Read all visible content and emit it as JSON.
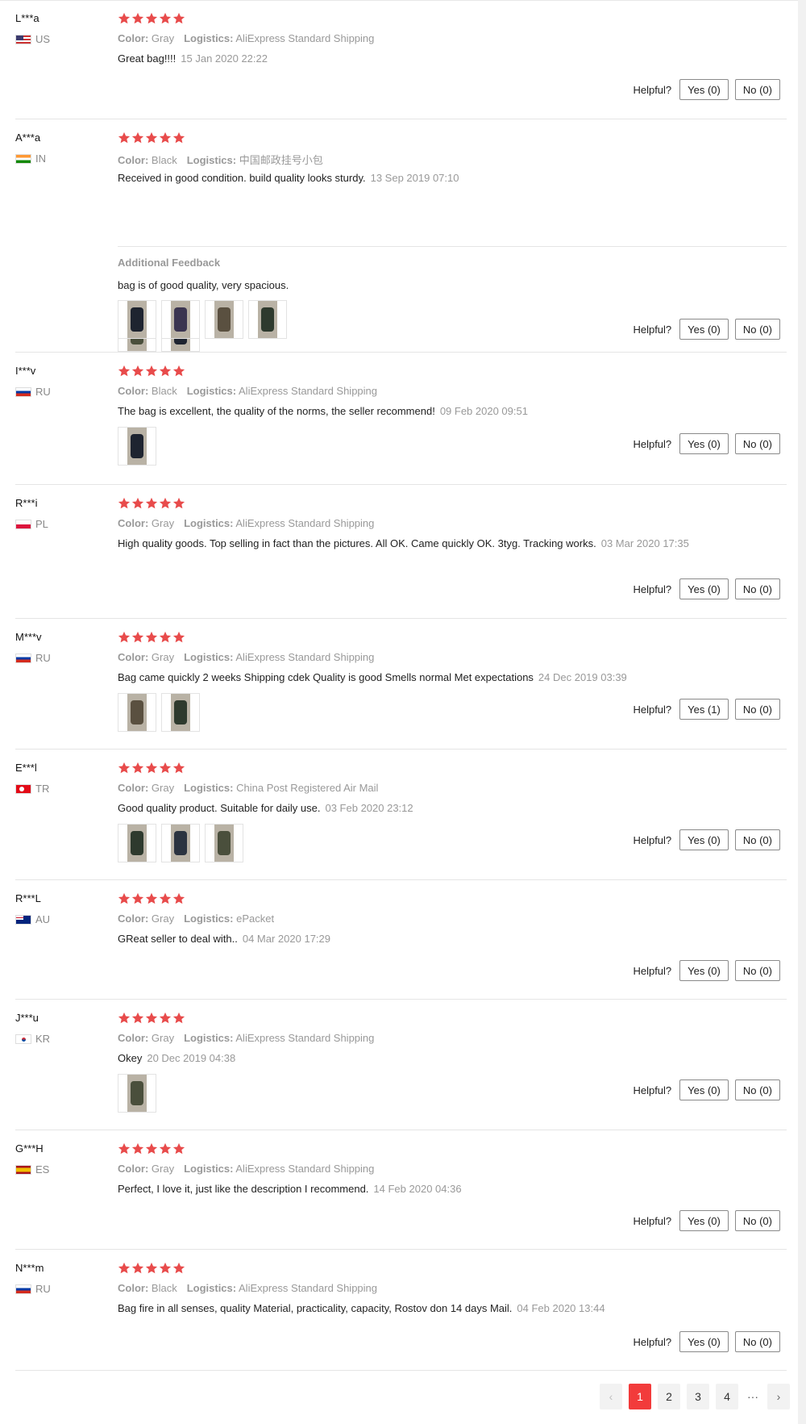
{
  "labels": {
    "color": "Color:",
    "logistics": "Logistics:",
    "helpful": "Helpful?",
    "additional_feedback": "Additional Feedback"
  },
  "colors": {
    "star": "#e84b4b",
    "accent": "#f23b3b",
    "muted": "#999999",
    "divider": "#e5e5e5"
  },
  "reviews": [
    {
      "user": "L***a",
      "country": "US",
      "flag": "us-flag-icon",
      "rating": 5,
      "color": "Gray",
      "logistics": "AliExpress Standard Shipping",
      "text": "Great bag!!!!",
      "date": "15 Jan 2020 22:22",
      "photos": 0,
      "yes": "Yes (0)",
      "no": "No (0)"
    },
    {
      "user": "A***a",
      "country": "IN",
      "flag": "in-flag-icon",
      "rating": 5,
      "color": "Black",
      "logistics": "中国邮政挂号小包",
      "text": "Received in good condition. build quality looks sturdy.",
      "date": "13 Sep 2019 07:10",
      "photos": 2,
      "yes": "Yes (0)",
      "no": "No (0)",
      "additional": {
        "text": "bag is of good quality, very spacious.",
        "photos": 4
      }
    },
    {
      "user": "I***v",
      "country": "RU",
      "flag": "ru-flag-icon",
      "rating": 5,
      "color": "Black",
      "logistics": "AliExpress Standard Shipping",
      "text": "The bag is excellent, the quality of the norms, the seller recommend!",
      "date": "09 Feb 2020 09:51",
      "photos": 1,
      "yes": "Yes (0)",
      "no": "No (0)"
    },
    {
      "user": "R***i",
      "country": "PL",
      "flag": "pl-flag-icon",
      "rating": 5,
      "color": "Gray",
      "logistics": "AliExpress Standard Shipping",
      "text": "High quality goods. Top selling in fact than the pictures. All OK. Came quickly OK. 3tyg. Tracking works.",
      "date": "03 Mar 2020 17:35",
      "photos": 0,
      "yes": "Yes (0)",
      "no": "No (0)"
    },
    {
      "user": "M***v",
      "country": "RU",
      "flag": "ru-flag-icon",
      "rating": 5,
      "color": "Gray",
      "logistics": "AliExpress Standard Shipping",
      "text": "Bag came quickly 2 weeks Shipping cdek Quality is good Smells normal Met expectations",
      "date": "24 Dec 2019 03:39",
      "photos": 2,
      "yes": "Yes (1)",
      "no": "No (0)"
    },
    {
      "user": "E***l",
      "country": "TR",
      "flag": "tr-flag-icon",
      "rating": 5,
      "color": "Gray",
      "logistics": "China Post Registered Air Mail",
      "text": "Good quality product. Suitable for daily use.",
      "date": "03 Feb 2020 23:12",
      "photos": 3,
      "yes": "Yes (0)",
      "no": "No (0)"
    },
    {
      "user": "R***L",
      "country": "AU",
      "flag": "au-flag-icon",
      "rating": 5,
      "color": "Gray",
      "logistics": "ePacket",
      "text": "GReat seller to deal with..",
      "date": "04 Mar 2020 17:29",
      "photos": 0,
      "yes": "Yes (0)",
      "no": "No (0)"
    },
    {
      "user": "J***u",
      "country": "KR",
      "flag": "kr-flag-icon",
      "rating": 5,
      "color": "Gray",
      "logistics": "AliExpress Standard Shipping",
      "text": "Okey",
      "date": "20 Dec 2019 04:38",
      "photos": 1,
      "yes": "Yes (0)",
      "no": "No (0)"
    },
    {
      "user": "G***H",
      "country": "ES",
      "flag": "es-flag-icon",
      "rating": 5,
      "color": "Gray",
      "logistics": "AliExpress Standard Shipping",
      "text": "Perfect, I love it, just like the description I recommend.",
      "date": "14 Feb 2020 04:36",
      "photos": 0,
      "yes": "Yes (0)",
      "no": "No (0)"
    },
    {
      "user": "N***m",
      "country": "RU",
      "flag": "ru-flag-icon",
      "rating": 5,
      "color": "Black",
      "logistics": "AliExpress Standard Shipping",
      "text": "Bag fire in all senses, quality Material, practicality, capacity, Rostov don 14 days Mail.",
      "date": "04 Feb 2020 13:44",
      "photos": 0,
      "yes": "Yes (0)",
      "no": "No (0)"
    }
  ],
  "pagination": {
    "pages": [
      "1",
      "2",
      "3",
      "4"
    ],
    "current": "1",
    "ellipsis": "···",
    "prev_icon": "chevron-left-icon",
    "next_icon": "chevron-right-icon"
  }
}
